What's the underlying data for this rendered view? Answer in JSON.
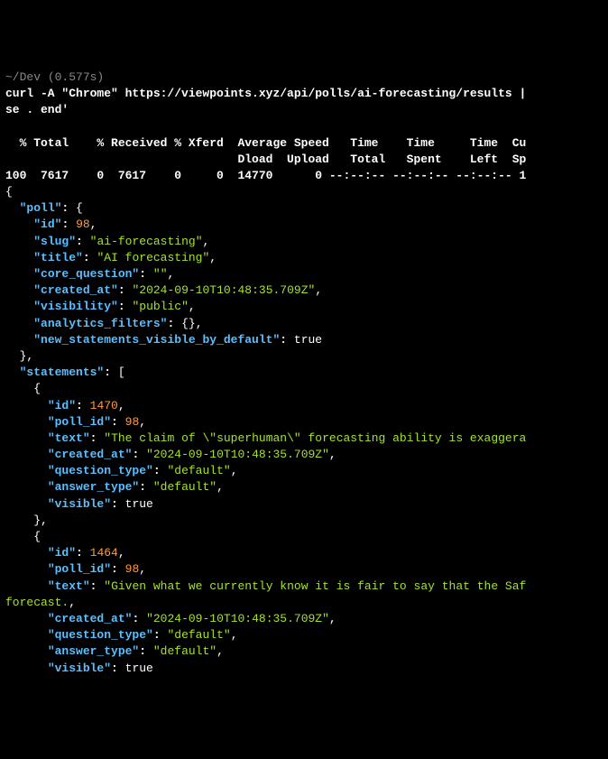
{
  "prompt": {
    "path": "~/Dev",
    "timing": "(0.577s)"
  },
  "command": {
    "line1": "curl -A \"Chrome\" https://viewpoints.xyz/api/polls/ai-forecasting/results |",
    "line2": "se . end'"
  },
  "curl_header": {
    "row1": "  % Total    % Received % Xferd  Average Speed   Time    Time     Time  Cu",
    "row2": "                                 Dload  Upload   Total   Spent    Left  Sp",
    "row3": "100  7617    0  7617    0     0  14770      0 --:--:-- --:--:-- --:--:-- 1"
  },
  "json_output": {
    "poll": {
      "id": 98,
      "slug": "ai-forecasting",
      "title": "AI forecasting",
      "core_question": "",
      "created_at": "2024-09-10T10:48:35.709Z",
      "visibility": "public",
      "analytics_filters": "{}",
      "new_statements_visible_by_default": true
    },
    "statements": [
      {
        "id": 1470,
        "poll_id": 98,
        "text": "The claim of \\\"superhuman\\\" forecasting ability is exaggera",
        "created_at": "2024-09-10T10:48:35.709Z",
        "question_type": "default",
        "answer_type": "default",
        "visible": true
      },
      {
        "id": 1464,
        "poll_id": 98,
        "text_line1": "Given what we currently know it is fair to say that the Saf",
        "text_line2": "forecast.",
        "created_at": "2024-09-10T10:48:35.709Z",
        "question_type": "default",
        "answer_type": "default",
        "visible": true
      }
    ]
  }
}
